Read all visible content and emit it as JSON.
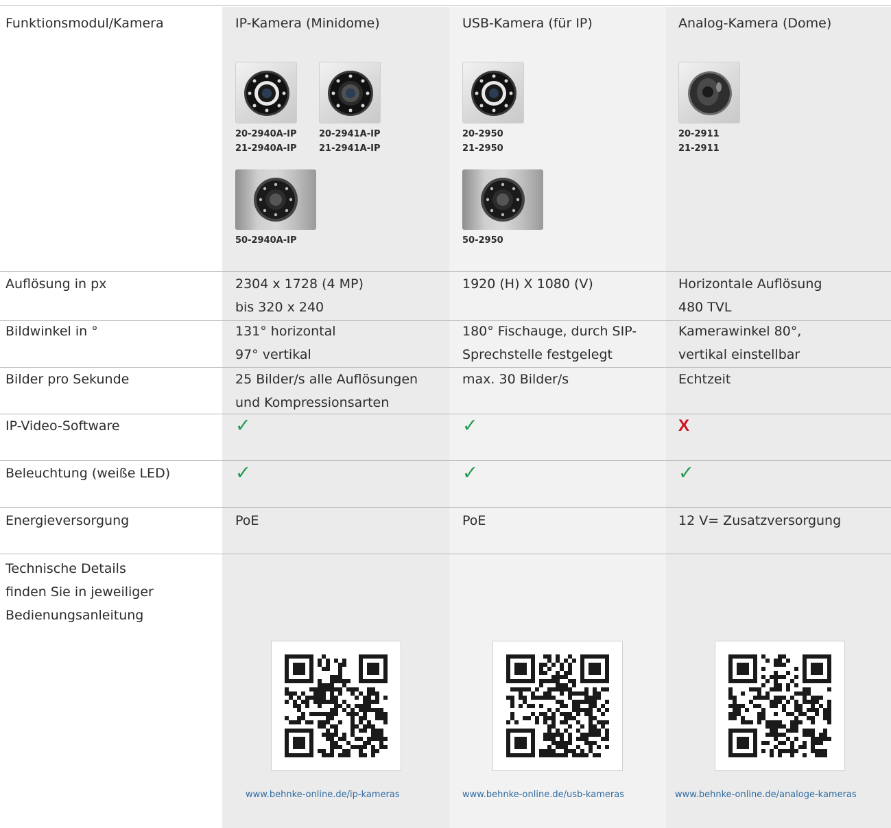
{
  "header": {
    "row_label": "Funktionsmodul/Kamera",
    "columns": [
      "IP-Kamera (Minidome)",
      "USB-Kamera (für IP)",
      "Analog-Kamera (Dome)"
    ]
  },
  "products": {
    "ip_a": [
      "20-2940A-IP",
      "21-2940A-IP"
    ],
    "ip_b": [
      "20-2941A-IP",
      "21-2941A-IP"
    ],
    "ip_c": [
      "50-2940A-IP"
    ],
    "usb_a": [
      "20-2950",
      "21-2950"
    ],
    "usb_b": [
      "50-2950"
    ],
    "analog_a": [
      "20-2911",
      "21-2911"
    ]
  },
  "rows": [
    {
      "label": [
        "Auflösung in px"
      ],
      "cells": [
        [
          "2304 x 1728 (4 MP)",
          "bis 320 x 240"
        ],
        [
          "1920 (H) X 1080 (V)"
        ],
        [
          "Horizontale Auflösung",
          "480 TVL"
        ]
      ]
    },
    {
      "label": [
        "Bildwinkel in °"
      ],
      "cells": [
        [
          "131° horizontal",
          "97° vertikal"
        ],
        [
          "180° Fischauge, durch SIP-",
          "Sprechstelle festgelegt"
        ],
        [
          "Kamerawinkel 80°,",
          "vertikal einstellbar"
        ]
      ]
    },
    {
      "label": [
        "Bilder pro Sekunde"
      ],
      "cells": [
        [
          "25 Bilder/s alle Auflösungen",
          "und Kompressionsarten"
        ],
        [
          "max. 30 Bilder/s"
        ],
        [
          "Echtzeit"
        ]
      ]
    },
    {
      "label": [
        "IP-Video-Software"
      ],
      "marks": [
        "✓",
        "✓",
        "X"
      ],
      "mark_types": [
        "check",
        "check",
        "cross"
      ]
    },
    {
      "label": [
        "Beleuchtung (weiße LED)"
      ],
      "marks": [
        "✓",
        "✓",
        "✓"
      ],
      "mark_types": [
        "check",
        "check",
        "check"
      ]
    },
    {
      "label": [
        "Energieversorgung"
      ],
      "cells": [
        [
          "PoE"
        ],
        [
          "PoE"
        ],
        [
          "12 V= Zusatzversorgung"
        ]
      ]
    },
    {
      "label": [
        "Technische Details",
        "finden Sie in jeweiliger",
        "Bedienungsanleitung"
      ]
    }
  ],
  "links": [
    "www.behnke-online.de/ip-kameras",
    "www.behnke-online.de/usb-kameras",
    "www.behnke-online.de/analoge-kameras"
  ],
  "colors": {
    "column_bg": "#ebebeb",
    "rule": "#b7b7b7",
    "check": "#1e9a4f",
    "cross": "#d0101e",
    "link": "#2e6aa0"
  }
}
